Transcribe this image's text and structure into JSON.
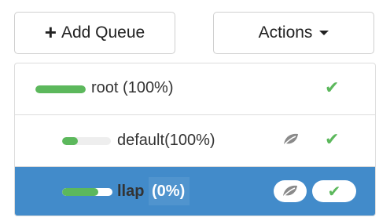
{
  "toolbar": {
    "add_queue_icon": "+",
    "add_queue_label": "Add Queue",
    "actions_label": "Actions"
  },
  "queues": [
    {
      "name": "root",
      "capacity_label": "(100%)",
      "usage": 1.0,
      "leaf": false,
      "status": "running",
      "selected": false
    },
    {
      "name": "default",
      "capacity_label": "(100%)",
      "usage": 0.33,
      "leaf": true,
      "status": "running",
      "selected": false
    },
    {
      "name": "llap",
      "capacity_label": "(0%)",
      "usage": 0.72,
      "leaf": true,
      "status": "running",
      "selected": true
    }
  ],
  "colors": {
    "accent": "#428bca",
    "success": "#5cb85c",
    "leaf_icon": "#888888"
  },
  "icons": {
    "status": "check-icon",
    "leaf": "leaf-icon"
  }
}
